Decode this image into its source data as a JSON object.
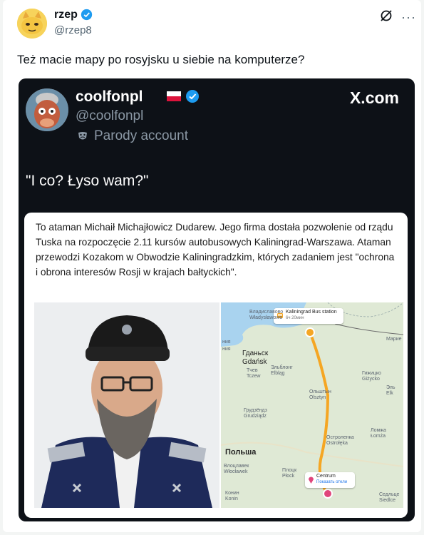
{
  "post": {
    "username": "rzep",
    "handle": "@rzep8",
    "text": "Też macie mapy po rosyjsku u siebie na komputerze?",
    "more_label": "···"
  },
  "embed": {
    "name": "coolfonpl",
    "handle": "@coolfonpl",
    "parody_label": "Parody account",
    "site": "X.com",
    "quote": "\"I co? Łyso wam?\"",
    "card_text": "To ataman Michaił Michajłowicz Dudarew. Jego firma dostała pozwolenie od rządu Tuska na rozpoczęcie 2.11 kursów autobusowych Kaliningrad-Warszawa. Ataman przewodzi Kozakom w Obwodzie Kaliningradzkim, których zadaniem jest \"ochrona i obrona interesów Rosji w krajach bałtyckich\"."
  },
  "map": {
    "start_title": "Kaliningrad Bus station",
    "start_sub": "6ч 20мин",
    "dest_title": "Centrum",
    "dest_sub": "Показать отели",
    "labels": {
      "l1": "Владиславово",
      "l2": "Władysławowo",
      "l3": "Гданьск",
      "l4": "Gdańsk",
      "l5": "Эльблонг",
      "l6": "Elbląg",
      "l7": "Тчев",
      "l8": "Tczew",
      "l9": "Ольштын",
      "l10": "Olsztyn",
      "l11": "Грудзёндз",
      "l12": "Grudziądz",
      "l13": "Польша",
      "l14": "Влоцлавек",
      "l15": "Włocławek",
      "l16": "Плоцк",
      "l17": "Płock",
      "l18": "Остроленка",
      "l19": "Ostrołęka",
      "l20": "Гижицко",
      "l21": "Giżycko",
      "l22": "Ломжа",
      "l23": "Łomża",
      "l24": "Седльце",
      "l25": "Siedlce",
      "l26": "Конин",
      "l27": "Konin",
      "l28": "Марие",
      "l29": "Elk",
      "l30": "Эль",
      "l31": "ния",
      "l32": "ния"
    }
  },
  "colors": {
    "verified": "#1d9bf0",
    "embed_bg": "#0d1117",
    "route": "#f5a623",
    "map_bg": "#dfe9d5",
    "dest_pin": "#e0457b"
  }
}
